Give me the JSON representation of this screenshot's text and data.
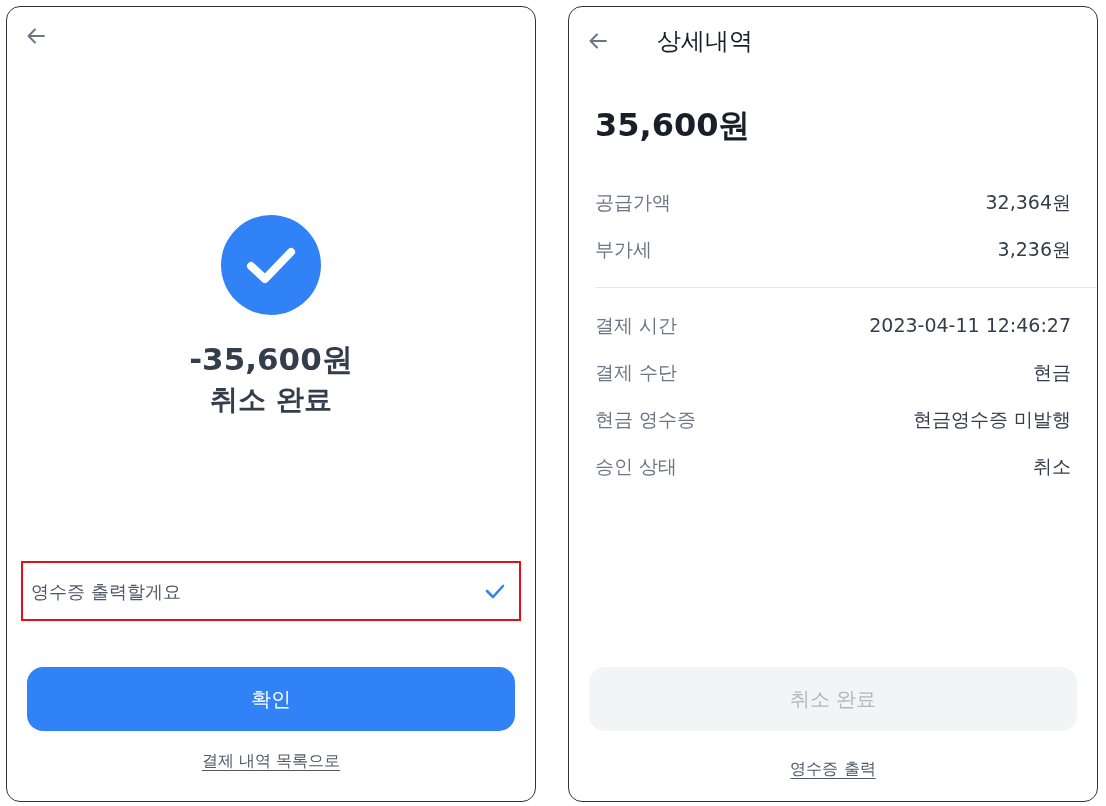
{
  "cancel_screen": {
    "amount": "-35,600원",
    "status": "취소 완료",
    "receipt_option": {
      "label": "영수증 출력할게요",
      "checked": true,
      "highlighted": true
    },
    "confirm_button": {
      "label": "확인",
      "disabled": false
    },
    "link": "결제 내역 목록으로"
  },
  "detail_screen": {
    "title": "상세내역",
    "amount": "35,600원",
    "groups": [
      [
        {
          "label": "공급가액",
          "value": "32,364원"
        },
        {
          "label": "부가세",
          "value": "3,236원"
        }
      ],
      [
        {
          "label": "결제 시간",
          "value": "2023-04-11 12:46:27"
        },
        {
          "label": "결제 수단",
          "value": "현금"
        },
        {
          "label": "현금 영수증",
          "value": "현금영수증 미발행"
        },
        {
          "label": "승인 상태",
          "value": "취소"
        }
      ]
    ],
    "action_button": {
      "label": "취소 완료",
      "disabled": true
    },
    "link": "영수증 출력"
  }
}
